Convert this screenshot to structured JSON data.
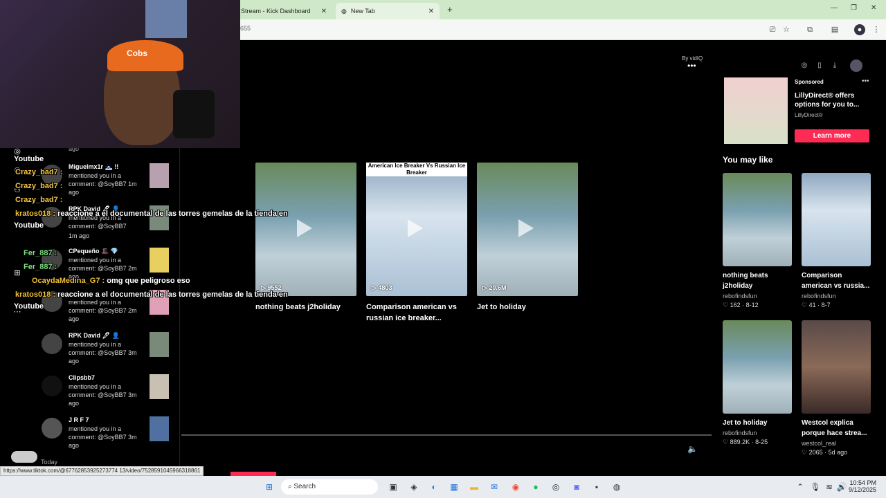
{
  "tabs": [
    {
      "label": "Stream - Kick Dashboard"
    },
    {
      "label": "New Tab"
    }
  ],
  "address": {
    "url": "655"
  },
  "branding": {
    "by": "By vidIQ"
  },
  "notifications": [
    {
      "name": "Miguelmx1r 🗻 !!",
      "text": "mentioned you in a comment: @SoyBB7 1m ago",
      "when": "ago"
    },
    {
      "name": "RPK David 🖊 👤",
      "text": "mentioned you in a comment: @SoyBB7",
      "when": "1m ago"
    },
    {
      "name": "CPequeño 🎩 💎",
      "text": "mentioned you in a comment: @SoyBB7 2m ago",
      "when": "ago"
    },
    {
      "name": "",
      "text": "mentioned you in a comment: @SoyBB7 2m ago",
      "when": "ago"
    },
    {
      "name": "RPK David 🖊 👤",
      "text": "mentioned you in a comment: @SoyBB7 3m ago",
      "when": "ago"
    },
    {
      "name": "Clipsbb7",
      "text": "mentioned you in a comment: @SoyBB7 3m ago",
      "when": "ago"
    },
    {
      "name": "J R F 7",
      "text": "mentioned you in a comment: @SoyBB7 3m ago",
      "when": "ago"
    }
  ],
  "notif_top": {
    "ago": "ago"
  },
  "notif_today": "Today",
  "chat": [
    {
      "user": "Youtube",
      "msg": ""
    },
    {
      "user": "Crazy_bad7 :",
      "msg": ""
    },
    {
      "user": "Crazy_bad7 :",
      "msg": ""
    },
    {
      "user": "Crazy_bad7 :",
      "msg": ""
    },
    {
      "user": "kratos018 :",
      "msg": "reaccione a el documental de las torres gemelas de la tienda en"
    },
    {
      "user": "Youtube",
      "msg": ""
    },
    {
      "user": "Fer_887 :",
      "msg": ""
    },
    {
      "user": "Fer_887 :",
      "msg": ""
    },
    {
      "user": "OcaydaMedina_G7 :",
      "msg": "omg que peligroso eso"
    },
    {
      "user": "kratos018 :",
      "msg": "reaccione a el documental de las torres gemelas de la tienda en"
    },
    {
      "user": "Youtube",
      "msg": ""
    }
  ],
  "videos": [
    {
      "views": "9552",
      "title": "nothing beats j2holiday",
      "overlay": ""
    },
    {
      "views": "4803",
      "title": "Comparison american vs russian ice breaker...",
      "overlay": "American Ice Breaker Vs Russian Ice Breaker"
    },
    {
      "views": "20.6M",
      "title": "Jet to holiday",
      "overlay": ""
    }
  ],
  "ad": {
    "label": "Sponsored",
    "text": "LillyDirect® offers options for you to...",
    "brand": "LillyDirect®",
    "cta": "Learn more"
  },
  "you_may_like": {
    "heading": "You may like",
    "items": [
      {
        "title": "nothing beats j2holiday",
        "author": "rebofindsfun",
        "likes": "162",
        "date": "8-12"
      },
      {
        "title": "Comparison american vs russia...",
        "author": "rebofindsfun",
        "likes": "41",
        "date": "8-7"
      },
      {
        "title": "Jet to holiday",
        "author": "rebofindsfun",
        "likes": "889.2K",
        "date": "8-25"
      },
      {
        "title": "Westcol explica porque hace strea...",
        "author": "westcol_real",
        "likes": "2065",
        "date": "5d ago"
      }
    ]
  },
  "status_url": "https://www.tiktok.com/@67762853925273774 13/video/7528591045966318861",
  "taskbar": {
    "search": "Search",
    "time": "10:54 PM",
    "date": "9/12/2025"
  },
  "colors": {
    "accent": "#fe2c55",
    "tab_bg": "#cfe8c8"
  }
}
